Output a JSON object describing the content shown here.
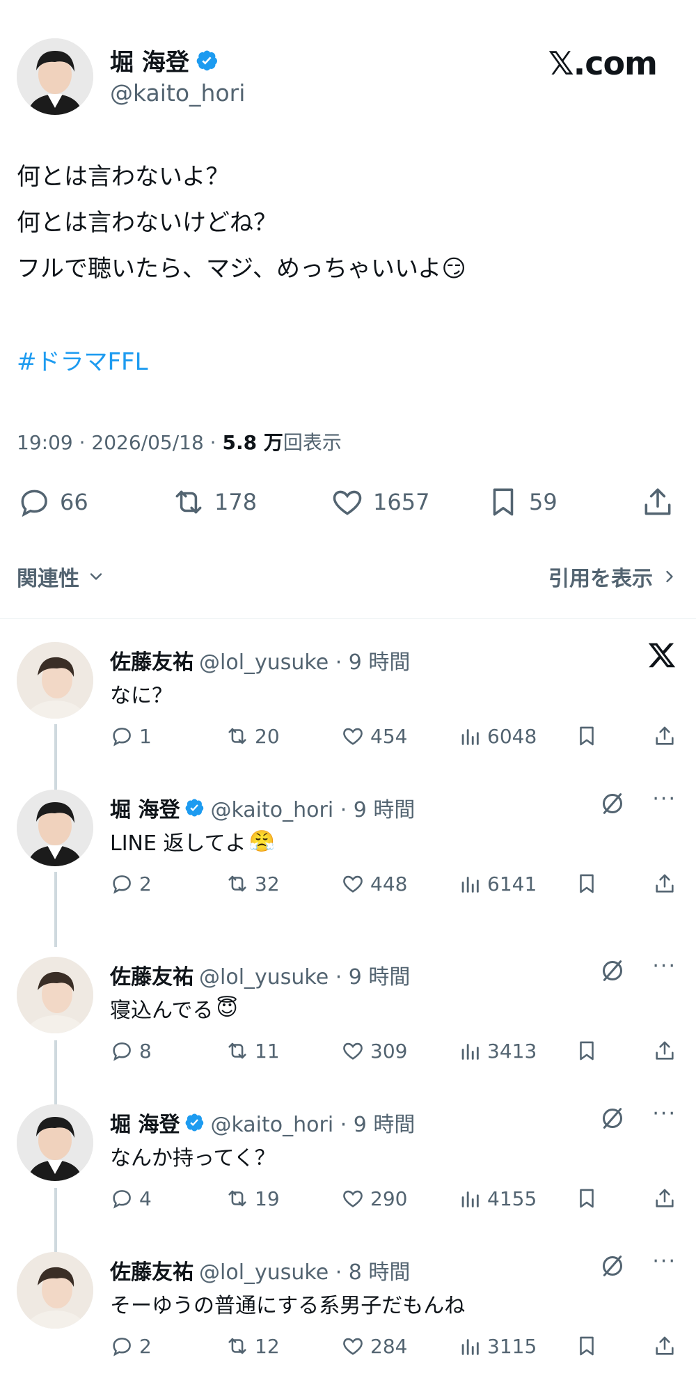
{
  "brand": "𝕏.com",
  "tweet": {
    "author_name": "堀 海登",
    "handle": "@kaito_hori",
    "lines": [
      "何とは言わないよ？",
      "何とは言わないけどね？",
      "フルで聴いたら、マジ、めっちゃいいよ"
    ],
    "line3_emoji": "😏",
    "hashtag": "#ドラマFFL",
    "time": "19:09 · 2026/05/18 · ",
    "views_count": "5.8 万",
    "views_label": "回表示",
    "replies": "66",
    "reposts": "178",
    "likes": "1657",
    "bookmarks": "59"
  },
  "filters": {
    "relevance": "関連性",
    "quotes": "引用を表示"
  },
  "colors": {
    "accent": "#1d9bf0",
    "secondary_text": "#536471",
    "primary_text": "#0f1419"
  },
  "replies": [
    {
      "name": "佐藤友祐",
      "verified": false,
      "handle": "@lol_yusuke · 9 時間",
      "text": "なに？",
      "emoji": "",
      "replies": "1",
      "reposts": "20",
      "likes": "454",
      "views": "6048"
    },
    {
      "name": "堀 海登",
      "verified": true,
      "handle": "@kaito_hori · 9 時間",
      "text": "LINE 返してよ",
      "emoji": "😤",
      "replies": "2",
      "reposts": "32",
      "likes": "448",
      "views": "6141"
    },
    {
      "name": "佐藤友祐",
      "verified": false,
      "handle": "@lol_yusuke · 9 時間",
      "text": "寝込んでる",
      "emoji": "😇",
      "replies": "8",
      "reposts": "11",
      "likes": "309",
      "views": "3413"
    },
    {
      "name": "堀 海登",
      "verified": true,
      "handle": "@kaito_hori · 9 時間",
      "text": "なんか持ってく？",
      "emoji": "",
      "replies": "4",
      "reposts": "19",
      "likes": "290",
      "views": "4155"
    },
    {
      "name": "佐藤友祐",
      "verified": false,
      "handle": "@lol_yusuke · 8 時間",
      "text": "そーゆうの普通にする系男子だもんね",
      "emoji": "",
      "replies": "2",
      "reposts": "12",
      "likes": "284",
      "views": "3115"
    }
  ]
}
